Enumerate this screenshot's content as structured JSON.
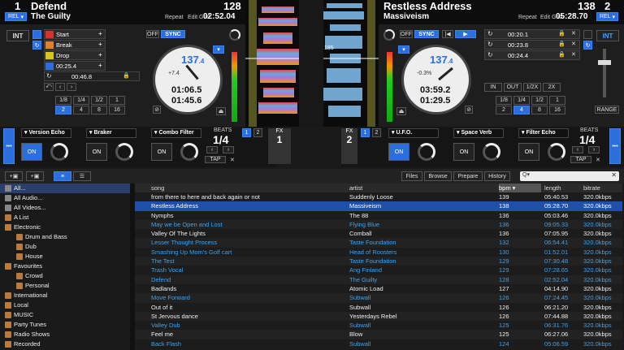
{
  "left_deck": {
    "deck_number": "1",
    "bpm": "128",
    "title": "Defend",
    "artist": "The Guilty",
    "rel_label": "REL",
    "repeat_label": "Repeat",
    "edit_grid_label": "Edit Grid",
    "time_remaining": "02:52.04",
    "int_label": "INT",
    "off_label": "OFF",
    "sync_label": "SYNC",
    "platter_bpm_main": "137",
    "platter_bpm_dec": ".4",
    "platter_pitch": "+7.4",
    "platter_time1": "01:06.5",
    "platter_time2": "01:45.6",
    "cues": [
      {
        "label": "Start",
        "color": "#d9302c"
      },
      {
        "label": "Break",
        "color": "#e0802a"
      },
      {
        "label": "Drop",
        "color": "#d7c41e"
      },
      {
        "label": "00:25.4",
        "color": "#2a6fdb"
      }
    ],
    "loop_time": "00:46.8",
    "loop_sizes_row1": [
      "1/8",
      "1/4",
      "1/2",
      "1"
    ],
    "loop_sizes_row2": [
      "2",
      "4",
      "8",
      "16"
    ]
  },
  "right_deck": {
    "deck_number": "2",
    "bpm": "138",
    "title": "Restless Address",
    "artist": "Massiveism",
    "rel_label": "REL",
    "repeat_label": "Repeat",
    "edit_grid_label": "Edit Grid",
    "time_remaining": "05:28.70",
    "int_label": "INT",
    "off_label": "OFF",
    "sync_label": "SYNC",
    "platter_bpm_main": "137",
    "platter_bpm_dec": ".4",
    "platter_pitch": "-0.3%",
    "platter_time1": "03:59.2",
    "platter_time2": "01:29.5",
    "cues": [
      "00:20.1",
      "00:23.8",
      "00:24.4"
    ],
    "loop_labels": [
      "IN",
      "OUT",
      "1/2X",
      "2X"
    ],
    "loop_sizes_row1": [
      "1/8",
      "1/4",
      "1/2",
      "1"
    ],
    "loop_sizes_row2": [
      "2",
      "4",
      "8",
      "16"
    ],
    "range_label": "RANGE"
  },
  "waveform": {
    "beat_number": "185"
  },
  "fx_left": {
    "slots": [
      "Version Echo",
      "Braker",
      "Combo Filter"
    ],
    "on_label": "ON",
    "beats_label": "BEATS",
    "beats_value": "1/4",
    "tap_label": "TAP",
    "fx_label": "FX",
    "fx_num": "1",
    "deck_buttons": [
      "1",
      "2"
    ]
  },
  "fx_right": {
    "slots": [
      "U.F.O.",
      "Space Verb",
      "Filter Echo"
    ],
    "on_label": "ON",
    "beats_label": "BEATS",
    "beats_value": "1/4",
    "tap_label": "TAP",
    "fx_label": "FX",
    "fx_num": "2",
    "deck_buttons": [
      "1",
      "2"
    ]
  },
  "browser": {
    "tabs": [
      "Files",
      "Browse",
      "Prepare",
      "History"
    ],
    "search_placeholder": "Q▾",
    "sidebar": [
      {
        "label": "All...",
        "level": 0,
        "icon": "gray"
      },
      {
        "label": "All Audio...",
        "level": 0,
        "icon": "gray"
      },
      {
        "label": "All Videos...",
        "level": 0,
        "icon": "gray"
      },
      {
        "label": "A List",
        "level": 0,
        "icon": "crate"
      },
      {
        "label": "Electronic",
        "level": 0,
        "icon": "crate"
      },
      {
        "label": "Drum and Bass",
        "level": 1,
        "icon": "crate"
      },
      {
        "label": "Dub",
        "level": 1,
        "icon": "crate"
      },
      {
        "label": "House",
        "level": 1,
        "icon": "crate"
      },
      {
        "label": "Favourites",
        "level": 0,
        "icon": "crate"
      },
      {
        "label": "Crowd",
        "level": 1,
        "icon": "crate"
      },
      {
        "label": "Personal",
        "level": 1,
        "icon": "crate"
      },
      {
        "label": "International",
        "level": 0,
        "icon": "crate"
      },
      {
        "label": "Local",
        "level": 0,
        "icon": "crate"
      },
      {
        "label": "MUSIC",
        "level": 0,
        "icon": "crate"
      },
      {
        "label": "Party Tunes",
        "level": 0,
        "icon": "crate"
      },
      {
        "label": "Radio Shows",
        "level": 0,
        "icon": "crate"
      },
      {
        "label": "Recorded",
        "level": 0,
        "icon": "crate"
      }
    ],
    "columns": [
      "song",
      "artist",
      "bpm",
      "length",
      "bitrate"
    ],
    "rows": [
      {
        "song": "from there to here and back again or not",
        "artist": "Suddenly Loose",
        "bpm": "139",
        "length": "05:40.53",
        "bitrate": "320.0kbps",
        "style": "white"
      },
      {
        "song": "Restless Address",
        "artist": "Massiveism",
        "bpm": "138",
        "length": "05:28.70",
        "bitrate": "320.0kbps",
        "style": "sel"
      },
      {
        "song": "Nymphs",
        "artist": "The 88",
        "bpm": "136",
        "length": "05:03.46",
        "bitrate": "320.0kbps",
        "style": "white"
      },
      {
        "song": "May we be Open and Lost",
        "artist": "Flying Blue",
        "bpm": "136",
        "length": "09:05.33",
        "bitrate": "320.0kbps",
        "style": "blue"
      },
      {
        "song": "Valley Of The Lights",
        "artist": "Comball",
        "bpm": "136",
        "length": "07:05.95",
        "bitrate": "320.0kbps",
        "style": "white"
      },
      {
        "song": "Lesser Thought Process",
        "artist": "Taste Foundation",
        "bpm": "132",
        "length": "06:54.41",
        "bitrate": "320.0kbps",
        "style": "blue"
      },
      {
        "song": "Smashing Up Mom's Golf cart",
        "artist": "Head of Roosters",
        "bpm": "130",
        "length": "01:52.01",
        "bitrate": "320.0kbps",
        "style": "blue"
      },
      {
        "song": "The Test",
        "artist": "Taste Foundation",
        "bpm": "129",
        "length": "07:30.48",
        "bitrate": "320.0kbps",
        "style": "blue"
      },
      {
        "song": "Trash Vocal",
        "artist": "Ang Finland",
        "bpm": "129",
        "length": "07:28.65",
        "bitrate": "320.0kbps",
        "style": "blue"
      },
      {
        "song": "Defend",
        "artist": "The Guilty",
        "bpm": "128",
        "length": "02:52.04",
        "bitrate": "320.0kbps",
        "style": "blue"
      },
      {
        "song": "Badlands",
        "artist": "Atomic Load",
        "bpm": "127",
        "length": "04:14.90",
        "bitrate": "320.0kbps",
        "style": "white"
      },
      {
        "song": "Move Forward",
        "artist": "Subwall",
        "bpm": "126",
        "length": "07:24.45",
        "bitrate": "320.0kbps",
        "style": "blue"
      },
      {
        "song": "Out of it",
        "artist": "Subwall",
        "bpm": "126",
        "length": "06:21.20",
        "bitrate": "320.0kbps",
        "style": "white"
      },
      {
        "song": "St Jervous dance",
        "artist": "Yesterdays Rebel",
        "bpm": "126",
        "length": "07:44.88",
        "bitrate": "320.0kbps",
        "style": "white"
      },
      {
        "song": "Valley Dub",
        "artist": "Subwall",
        "bpm": "125",
        "length": "06:31.76",
        "bitrate": "320.0kbps",
        "style": "blue"
      },
      {
        "song": "Feel me",
        "artist": "Blow",
        "bpm": "125",
        "length": "06:27.06",
        "bitrate": "320.0kbps",
        "style": "white"
      },
      {
        "song": "Back Flash",
        "artist": "Subwall",
        "bpm": "124",
        "length": "05:06.59",
        "bitrate": "320.0kbps",
        "style": "blue"
      }
    ]
  }
}
